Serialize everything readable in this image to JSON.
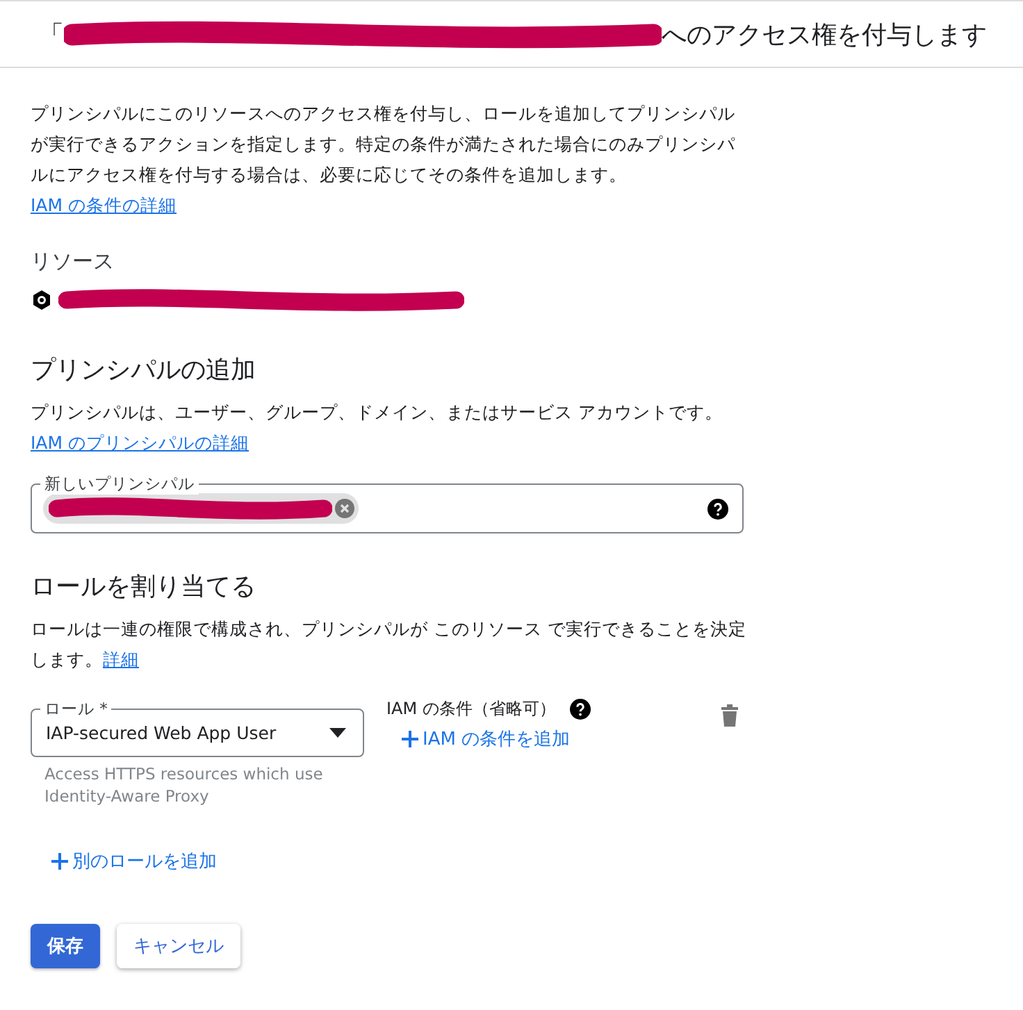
{
  "header": {
    "title_prefix": "「",
    "title_suffix": "へのアクセス権を付与します"
  },
  "intro": {
    "text": "プリンシパルにこのリソースへのアクセス権を付与し、ロールを追加してプリンシパルが実行できるアクションを指定します。特定の条件が満たされた場合にのみプリンシパルにアクセス権を付与する場合は、必要に応じてその条件を追加します。",
    "link": "IAM の条件の詳細"
  },
  "resource": {
    "label": "リソース"
  },
  "add_principals": {
    "heading": "プリンシパルの追加",
    "description": "プリンシパルは、ユーザー、グループ、ドメイン、またはサービス アカウントです。",
    "link": "IAM のプリンシパルの詳細",
    "field": {
      "label": "新しいプリンシパル"
    }
  },
  "assign_roles": {
    "heading": "ロールを割り当てる",
    "description": "ロールは一連の権限で構成され、プリンシパルが このリソース で実行できることを決定します。",
    "link": "詳細",
    "roles": [
      {
        "label": "ロール *",
        "value": "IAP-secured Web App User",
        "helper": "Access HTTPS resources which use Identity-Aware Proxy",
        "condition_label": "IAM の条件（省略可）",
        "add_condition": "IAM の条件を追加"
      }
    ],
    "add_role": "別のロールを追加"
  },
  "buttons": [
    {
      "label": "保存",
      "kind": "primary"
    },
    {
      "label": "キャンセル",
      "kind": "secondary"
    }
  ]
}
